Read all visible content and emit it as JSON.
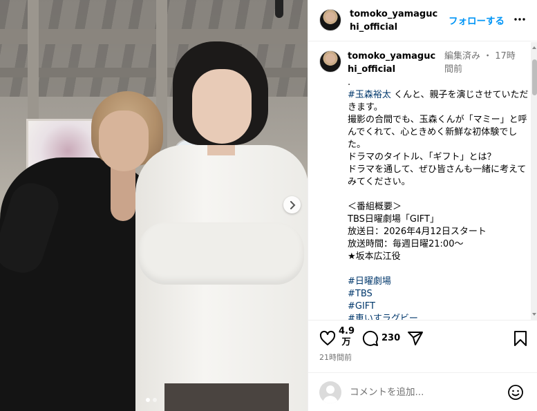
{
  "post": {
    "username": "tomoko_yamaguchi_official",
    "follow_label": "フォローする",
    "more_label": "•••"
  },
  "caption": {
    "username": "tomoko_yamaguchi_official",
    "meta": "編集済み ・ 17時間前",
    "lines": [
      {
        "text": "."
      },
      {
        "tag": "#玉森裕太",
        "text": " くんと、親子を演じさせていただきます。"
      },
      {
        "text": "撮影の合間でも、玉森くんが「マミー」と呼んでくれて、心ときめく新鮮な初体験でした。"
      },
      {
        "text": "ドラマのタイトル、「ギフト」とは？"
      },
      {
        "text": "ドラマを通して、ぜひ皆さんも一緒に考えてみてください。"
      },
      {
        "text": ""
      },
      {
        "text": "＜番組概要＞"
      },
      {
        "text": "TBS日曜劇場「GIFT」"
      },
      {
        "text": "放送日：2026年4月12日スタート"
      },
      {
        "text": "放送時間：毎週日曜21:00〜"
      },
      {
        "text": "★坂本広江役"
      },
      {
        "text": ""
      },
      {
        "tag": "#日曜劇場"
      },
      {
        "tag": "#TBS"
      },
      {
        "tag": "#GIFT"
      },
      {
        "tag": "#車いすラグビー"
      }
    ]
  },
  "actions": {
    "likes": "4.9万",
    "comments": "230",
    "timestamp": "21時間前"
  },
  "comment_bar": {
    "placeholder": "コメントを追加..."
  },
  "carousel": {
    "current": 1,
    "total": 2
  }
}
